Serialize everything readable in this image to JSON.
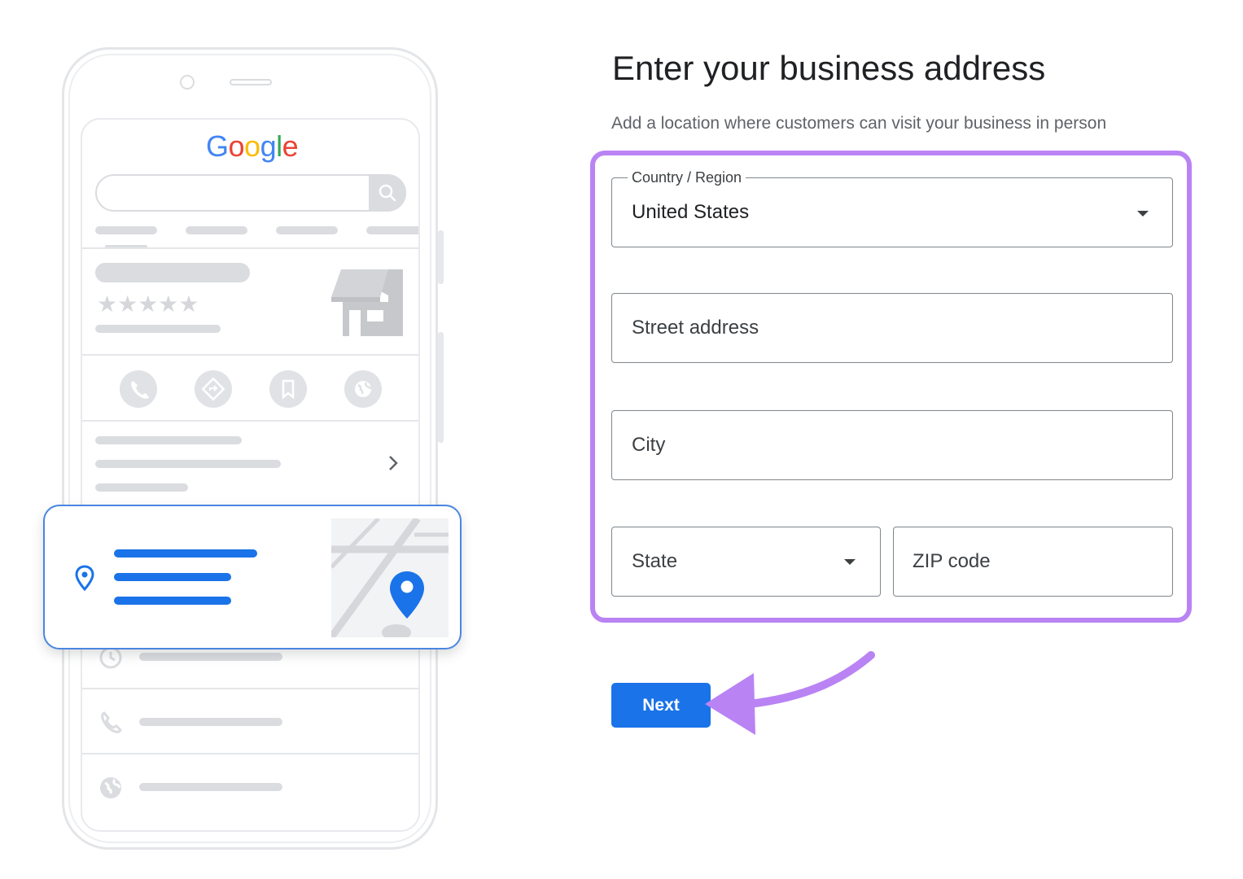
{
  "illustration": {
    "logo_text": "Google",
    "logo_colors": [
      "#4285F4",
      "#EA4335",
      "#FBBC05",
      "#4285F4",
      "#34A853",
      "#EA4335"
    ],
    "icons": [
      "search-icon",
      "phone-icon",
      "directions-icon",
      "bookmark-icon",
      "globe-icon",
      "chevron-right-icon",
      "location-pin-icon",
      "clock-icon",
      "storefront-icon",
      "map-pin-icon"
    ]
  },
  "form": {
    "title": "Enter your business address",
    "subtitle": "Add a location where customers can visit your business in person",
    "country": {
      "label": "Country / Region",
      "value": "United States"
    },
    "street": {
      "placeholder": "Street address"
    },
    "city": {
      "placeholder": "City"
    },
    "state": {
      "placeholder": "State"
    },
    "zip": {
      "placeholder": "ZIP code"
    },
    "next_label": "Next"
  },
  "colors": {
    "accent_blue": "#1a73e8",
    "highlight_purple": "#b983f4"
  }
}
